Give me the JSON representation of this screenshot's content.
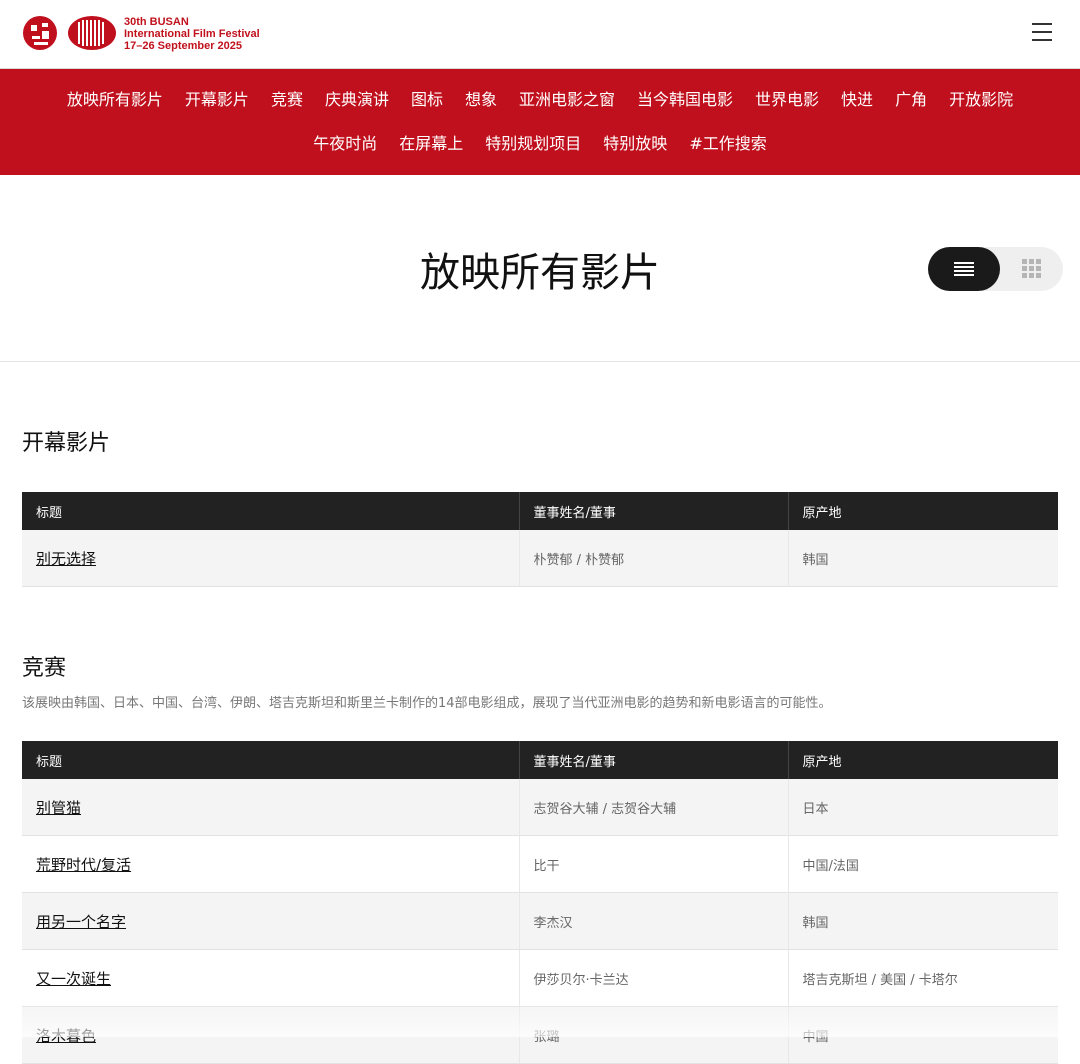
{
  "header": {
    "festival_line1": "30th BUSAN",
    "festival_line2": "International Film Festival",
    "festival_line3": "17–26 September 2025",
    "menu_icon": "hamburger-menu-icon"
  },
  "nav": {
    "row1": [
      "放映所有影片",
      "开幕影片",
      "竞赛",
      "庆典演讲",
      "图标",
      "想象",
      "亚洲电影之窗",
      "当今韩国电影",
      "世界电影",
      "快进",
      "广角",
      "开放影院"
    ],
    "row2": [
      "午夜时尚",
      "在屏幕上",
      "特别规划项目",
      "特别放映",
      "#工作搜索"
    ]
  },
  "page": {
    "title": "放映所有影片",
    "view_list_icon": "list-view-icon",
    "view_grid_icon": "grid-view-icon"
  },
  "sections": [
    {
      "title": "开幕影片",
      "description": "",
      "columns": [
        "标题",
        "董事姓名/董事",
        "原产地"
      ],
      "rows": [
        {
          "title": "别无选择",
          "director": "朴赞郁 / 朴赞郁",
          "origin": "韩国"
        }
      ]
    },
    {
      "title": "竞赛",
      "description": "该展映由韩国、日本、中国、台湾、伊朗、塔吉克斯坦和斯里兰卡制作的14部电影组成，展现了当代亚洲电影的趋势和新电影语言的可能性。",
      "columns": [
        "标题",
        "董事姓名/董事",
        "原产地"
      ],
      "rows": [
        {
          "title": "别管猫",
          "director": "志贺谷大辅 / 志贺谷大辅",
          "origin": "日本"
        },
        {
          "title": "荒野时代/复活",
          "director": "比干",
          "origin": "中国/法国"
        },
        {
          "title": "用另一个名字",
          "director": "李杰汉",
          "origin": "韩国"
        },
        {
          "title": "又一次诞生",
          "director": "伊莎贝尔·卡兰达",
          "origin": "塔吉克斯坦 / 美国 / 卡塔尔"
        },
        {
          "title": "洛木暮色",
          "director": "张璐",
          "origin": "中国"
        }
      ]
    }
  ],
  "colors": {
    "brand_red": "#c0101d",
    "table_header": "#222222"
  }
}
